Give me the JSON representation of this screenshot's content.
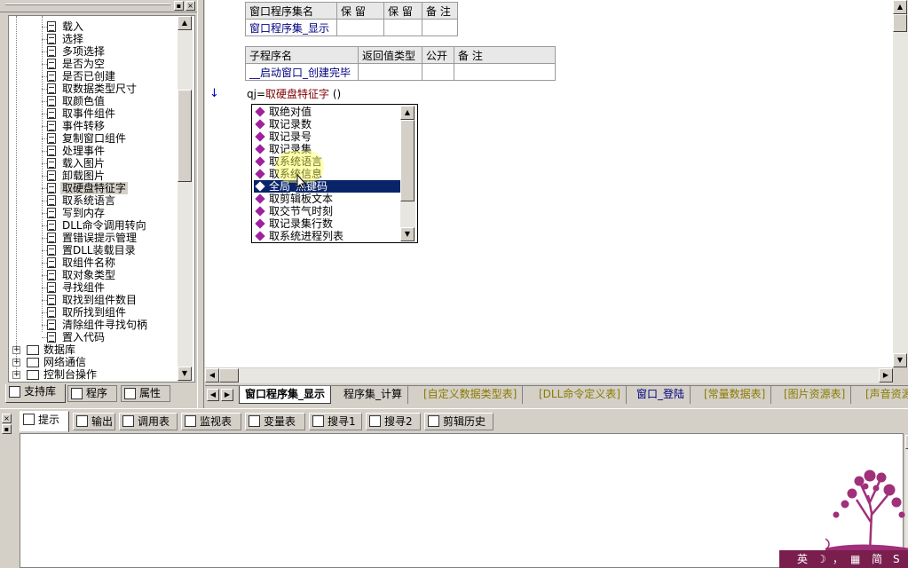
{
  "left_panel": {
    "tree_items": [
      "载入",
      "选择",
      "多项选择",
      "是否为空",
      "是否已创建",
      "取数据类型尺寸",
      "取颜色值",
      "取事件组件",
      "事件转移",
      "复制窗口组件",
      "处理事件",
      "载入图片",
      "卸载图片",
      "取硬盘特征字",
      "取系统语言",
      "写到内存",
      "DLL命令调用转向",
      "置错误提示管理",
      "置DLL装载目录",
      "取组件名称",
      "取对象类型",
      "寻找组件",
      "取找到组件数目",
      "取所找到组件",
      "清除组件寻找句柄",
      "置入代码"
    ],
    "groups": [
      "数据库",
      "网络通信",
      "控制台操作"
    ],
    "tabs": [
      "支持库",
      "程序",
      "属性"
    ]
  },
  "editor": {
    "table1": {
      "headers": [
        "窗口程序集名",
        "保 留",
        "保 留",
        "备 注"
      ],
      "row": [
        "窗口程序集_显示",
        "",
        "",
        ""
      ]
    },
    "table2": {
      "headers": [
        "子程序名",
        "返回值类型",
        "公开",
        "备 注"
      ],
      "row": [
        "__启动窗口_创建完毕",
        "",
        "",
        ""
      ]
    },
    "code_prefix": "qj=",
    "code_func": "取硬盘特征字",
    "code_suffix": " ()",
    "autocomplete": [
      "取绝对值",
      "取记录数",
      "取记录号",
      "取记录集",
      "取系统语言",
      "取系统信息",
      "全局_热键码",
      "取剪辑板文本",
      "取交节气时刻",
      "取记录集行数",
      "取系统进程列表"
    ],
    "autocomplete_selected_index": 6
  },
  "file_tabs": [
    "窗口程序集_显示",
    "程序集_计算",
    "[自定义数据类型表]",
    "[DLL命令定义表]",
    "窗口_登陆",
    "[常量数据表]",
    "[图片资源表]",
    "[声音资源"
  ],
  "bottom_tabs": [
    "提示",
    "输出",
    "调用表",
    "监视表",
    "变量表",
    "搜寻1",
    "搜寻2",
    "剪辑历史"
  ],
  "tray": {
    "ime": "英",
    "moon": "☽",
    "punct": "，",
    "kbd": "▦",
    "mode": "简",
    "s": "S"
  },
  "colors": {
    "selection": "#0a246a",
    "tray": "#7a1e4e",
    "deco": "#a0307a"
  }
}
